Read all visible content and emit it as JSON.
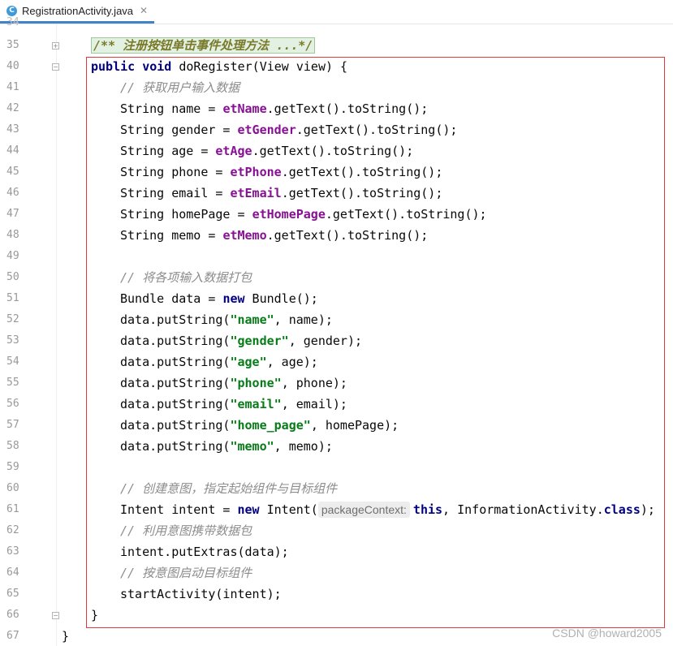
{
  "tab": {
    "icon_letter": "C",
    "title": "RegistrationActivity.java",
    "close": "✕"
  },
  "line_numbers": [
    "35",
    "40",
    "41",
    "42",
    "43",
    "44",
    "45",
    "46",
    "47",
    "48",
    "49",
    "50",
    "51",
    "52",
    "53",
    "54",
    "55",
    "56",
    "57",
    "58",
    "59",
    "60",
    "61",
    "62",
    "63",
    "64",
    "65",
    "66",
    "67"
  ],
  "code": {
    "folded_doc": "/** 注册按钮单击事件处理方法 ...*/",
    "l40": {
      "kw1": "public",
      "kw2": "void",
      "rest": " doRegister(View view) {"
    },
    "l41": "// 获取用户输入数据",
    "l42": {
      "pre": "String name = ",
      "field": "etName",
      "post": ".getText().toString();"
    },
    "l43": {
      "pre": "String gender = ",
      "field": "etGender",
      "post": ".getText().toString();"
    },
    "l44": {
      "pre": "String age = ",
      "field": "etAge",
      "post": ".getText().toString();"
    },
    "l45": {
      "pre": "String phone = ",
      "field": "etPhone",
      "post": ".getText().toString();"
    },
    "l46": {
      "pre": "String email = ",
      "field": "etEmail",
      "post": ".getText().toString();"
    },
    "l47": {
      "pre": "String homePage = ",
      "field": "etHomePage",
      "post": ".getText().toString();"
    },
    "l48": {
      "pre": "String memo = ",
      "field": "etMemo",
      "post": ".getText().toString();"
    },
    "l50": "// 将各项输入数据打包",
    "l51": {
      "pre": "Bundle data = ",
      "kw": "new",
      "post": " Bundle();"
    },
    "l52": {
      "pre": "data.putString(",
      "str": "\"name\"",
      "post": ", name);"
    },
    "l53": {
      "pre": "data.putString(",
      "str": "\"gender\"",
      "post": ", gender);"
    },
    "l54": {
      "pre": "data.putString(",
      "str": "\"age\"",
      "post": ", age);"
    },
    "l55": {
      "pre": "data.putString(",
      "str": "\"phone\"",
      "post": ", phone);"
    },
    "l56": {
      "pre": "data.putString(",
      "str": "\"email\"",
      "post": ", email);"
    },
    "l57": {
      "pre": "data.putString(",
      "str": "\"home_page\"",
      "post": ", homePage);"
    },
    "l58": {
      "pre": "data.putString(",
      "str": "\"memo\"",
      "post": ", memo);"
    },
    "l60": "// 创建意图，指定起始组件与目标组件",
    "l61": {
      "pre": "Intent intent = ",
      "kw": "new",
      "mid": " Intent(",
      "hint": "packageContext:",
      "kw_this": "this",
      "mid2": ", InformationActivity.",
      "kw_class": "class",
      "post": ");"
    },
    "l62": "// 利用意图携带数据包",
    "l63": "intent.putExtras(data);",
    "l64": "// 按意图启动目标组件",
    "l65": "startActivity(intent);",
    "l66": "}",
    "l67": "}"
  },
  "watermark": "CSDN @howard2005",
  "colors": {
    "keyword": "#0033b3",
    "field": "#871094",
    "string": "#067d17",
    "comment": "#8c8c8c",
    "highlight_box": "#e03a3a"
  }
}
